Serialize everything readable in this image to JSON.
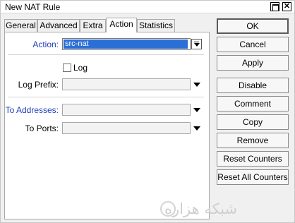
{
  "window": {
    "title": "New NAT Rule",
    "close_glyph": "✕"
  },
  "tabs": [
    {
      "label": "General"
    },
    {
      "label": "Advanced"
    },
    {
      "label": "Extra"
    },
    {
      "label": "Action",
      "active": true
    },
    {
      "label": "Statistics"
    }
  ],
  "form": {
    "action_label": "Action:",
    "action_value": "src-nat",
    "log_label": "Log",
    "log_checked": false,
    "log_prefix_label": "Log Prefix:",
    "log_prefix_value": "",
    "to_addresses_label": "To Addresses:",
    "to_addresses_value": "",
    "to_ports_label": "To Ports:",
    "to_ports_value": ""
  },
  "buttons": {
    "ok": "OK",
    "cancel": "Cancel",
    "apply": "Apply",
    "disable": "Disable",
    "comment": "Comment",
    "copy": "Copy",
    "remove": "Remove",
    "reset_counters": "Reset Counters",
    "reset_all_counters": "Reset All Counters"
  },
  "watermark": {
    "text": "شبکه هزاره"
  },
  "colors": {
    "selection": "#2a6fd6",
    "label_accent": "#1f3fbf"
  }
}
